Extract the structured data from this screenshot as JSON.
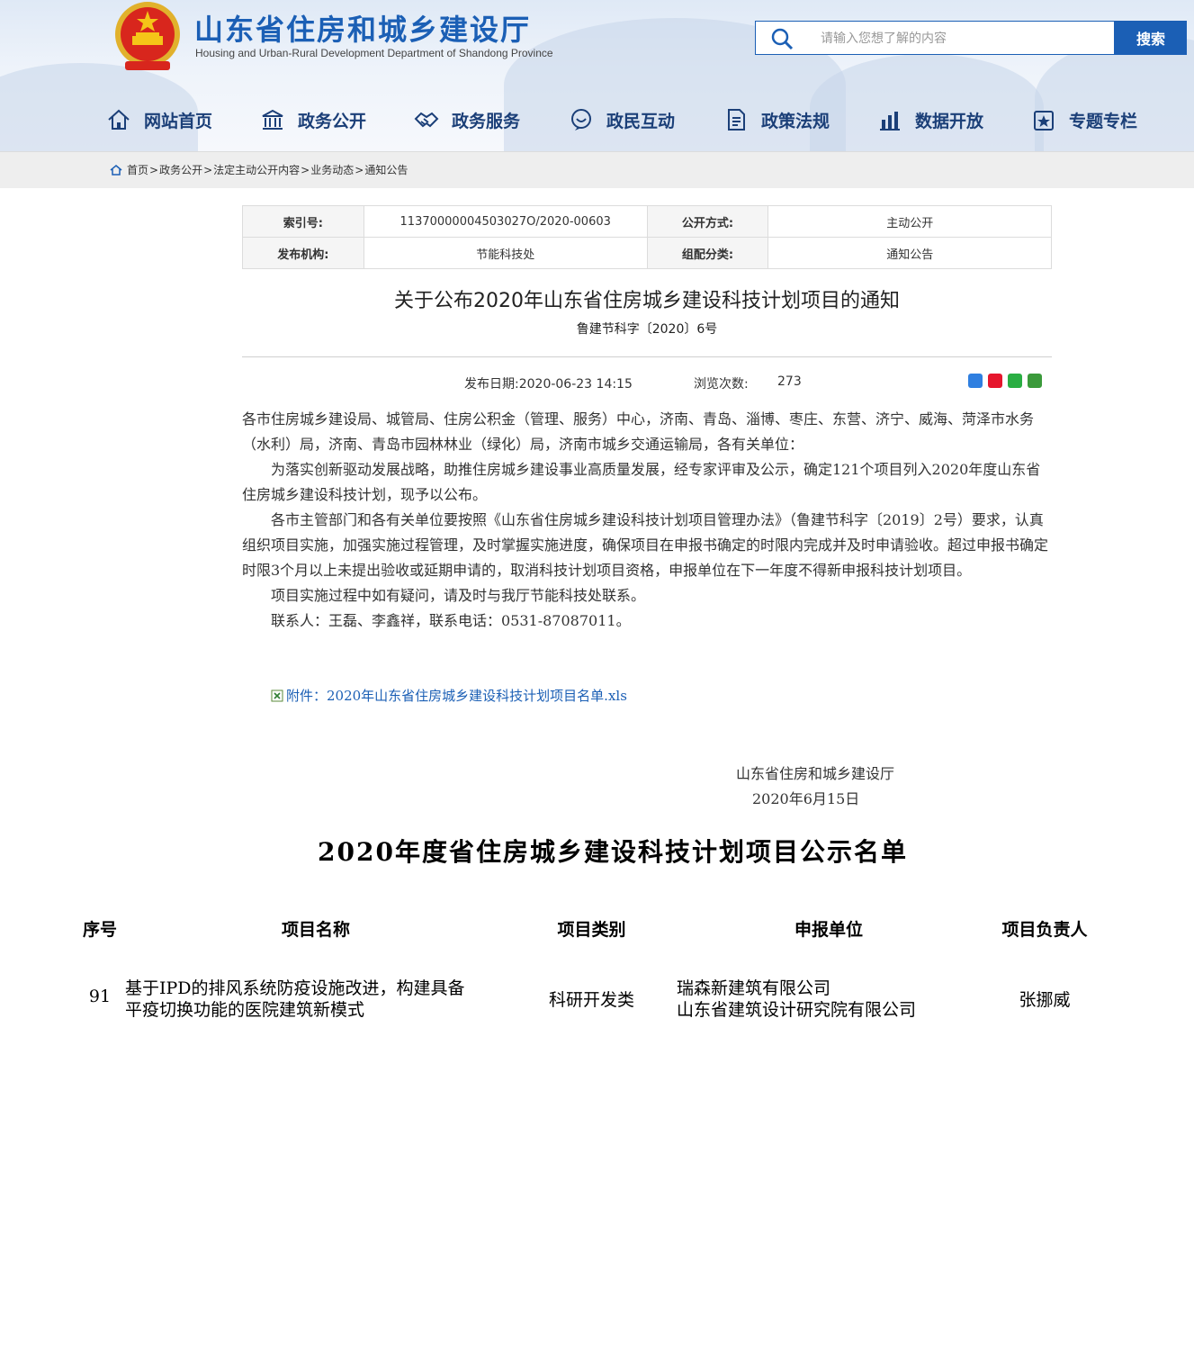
{
  "header": {
    "site_title": "山东省住房和城乡建设厅",
    "site_subtitle": "Housing and Urban-Rural Development Department of Shandong Province",
    "search_placeholder": "请输入您想了解的内容",
    "search_button": "搜索",
    "accent_color": "#1b5fb5"
  },
  "nav": [
    {
      "label": "网站首页",
      "icon": "home-icon"
    },
    {
      "label": "政务公开",
      "icon": "building-icon"
    },
    {
      "label": "政务服务",
      "icon": "handshake-icon"
    },
    {
      "label": "政民互动",
      "icon": "chat-icon"
    },
    {
      "label": "政策法规",
      "icon": "document-icon"
    },
    {
      "label": "数据开放",
      "icon": "chart-icon"
    },
    {
      "label": "专题专栏",
      "icon": "star-icon"
    }
  ],
  "breadcrumb": [
    "首页",
    "政务公开",
    "法定主动公开内容",
    "业务动态",
    "通知公告"
  ],
  "meta": {
    "index_label": "索引号:",
    "index_value": "11370000004503027O/2020-00603",
    "mode_label": "公开方式:",
    "mode_value": "主动公开",
    "org_label": "发布机构:",
    "org_value": "节能科技处",
    "category_label": "组配分类:",
    "category_value": "通知公告"
  },
  "article": {
    "title": "关于公布2020年山东省住房城乡建设科技计划项目的通知",
    "doc_number": "鲁建节科字〔2020〕6号",
    "publish_label": "发布日期:",
    "publish_date": "2020-06-23 14:15",
    "views_label": "浏览次数:",
    "views": "273",
    "paragraphs": [
      "各市住房城乡建设局、城管局、住房公积金（管理、服务）中心，济南、青岛、淄博、枣庄、东营、济宁、威海、菏泽市水务（水利）局，济南、青岛市园林林业（绿化）局，济南市城乡交通运输局，各有关单位：",
      "为落实创新驱动发展战略，助推住房城乡建设事业高质量发展，经专家评审及公示，确定121个项目列入2020年度山东省住房城乡建设科技计划，现予以公布。",
      "各市主管部门和各有关单位要按照《山东省住房城乡建设科技计划项目管理办法》（鲁建节科字〔2019〕2号）要求，认真组织项目实施，加强实施过程管理，及时掌握实施进度，确保项目在申报书确定的时限内完成并及时申请验收。超过申报书确定时限3个月以上未提出验收或延期申请的，取消科技计划项目资格，申报单位在下一年度不得新申报科技计划项目。",
      "项目实施过程中如有疑问，请及时与我厅节能科技处联系。",
      "联系人：王磊、李鑫祥，联系电话：0531-87087011。"
    ],
    "attachment": "附件：2020年山东省住房城乡建设科技计划项目名单.xls",
    "sign_org": "山东省住房和城乡建设厅",
    "sign_date": "2020年6月15日"
  },
  "project_list": {
    "title": "2020年度省住房城乡建设科技计划项目公示名单",
    "headers": [
      "序号",
      "项目名称",
      "项目类别",
      "申报单位",
      "项目负责人"
    ],
    "row": {
      "no": "91",
      "name_line1": "基于IPD的排风系统防疫设施改进，构建具备",
      "name_line2": "平疫切换功能的医院建筑新模式",
      "category": "科研开发类",
      "unit_line1": "瑞森新建筑有限公司",
      "unit_line2": "山东省建筑设计研究院有限公司",
      "leader": "张挪威"
    }
  }
}
